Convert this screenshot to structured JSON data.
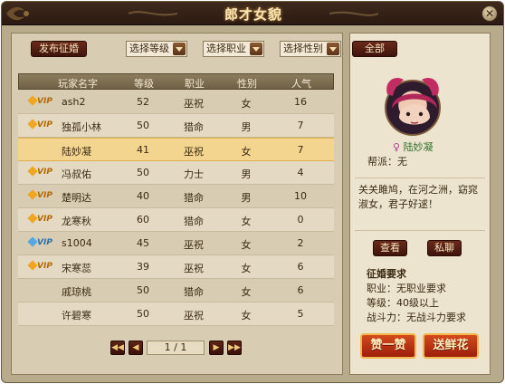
{
  "window": {
    "title": "郎才女貌",
    "close_glyph": "✕"
  },
  "toolbar": {
    "post_button": "发布征婚",
    "level_select": "选择等级",
    "job_select": "选择职业",
    "gender_select": "选择性别",
    "all_button": "全部"
  },
  "table": {
    "headers": [
      "玩家名字",
      "等级",
      "职业",
      "性别",
      "人气"
    ],
    "rows": [
      {
        "vip": "gold",
        "vip_label": "VIP",
        "name": "ash2",
        "level": "52",
        "job": "巫祝",
        "gender": "女",
        "popularity": "16"
      },
      {
        "vip": "gold",
        "vip_label": "VIP",
        "name": "独孤小林",
        "level": "50",
        "job": "猎命",
        "gender": "男",
        "popularity": "7"
      },
      {
        "vip": "",
        "vip_label": "",
        "name": "陆妙凝",
        "level": "41",
        "job": "巫祝",
        "gender": "女",
        "popularity": "7"
      },
      {
        "vip": "gold",
        "vip_label": "VIP",
        "name": "冯叔佑",
        "level": "50",
        "job": "力士",
        "gender": "男",
        "popularity": "4"
      },
      {
        "vip": "gold",
        "vip_label": "VIP",
        "name": "楚明达",
        "level": "40",
        "job": "猎命",
        "gender": "男",
        "popularity": "10"
      },
      {
        "vip": "gold",
        "vip_label": "VIP",
        "name": "龙寒秋",
        "level": "60",
        "job": "猎命",
        "gender": "女",
        "popularity": "0"
      },
      {
        "vip": "blue",
        "vip_label": "VIP",
        "name": "s1004",
        "level": "45",
        "job": "巫祝",
        "gender": "女",
        "popularity": "2"
      },
      {
        "vip": "gold",
        "vip_label": "VIP",
        "name": "宋寒蕊",
        "level": "39",
        "job": "巫祝",
        "gender": "女",
        "popularity": "6"
      },
      {
        "vip": "",
        "vip_label": "",
        "name": "戚琼桃",
        "level": "50",
        "job": "猎命",
        "gender": "女",
        "popularity": "6"
      },
      {
        "vip": "",
        "vip_label": "",
        "name": "许碧寒",
        "level": "50",
        "job": "巫祝",
        "gender": "女",
        "popularity": "5"
      }
    ],
    "selected_index": 2
  },
  "pagination": {
    "page": "1 / 1",
    "first": "◀◀",
    "prev": "◀",
    "next": "▶",
    "last": "▶▶"
  },
  "profile": {
    "name": "陆妙凝",
    "guild_label": "帮派：无",
    "motto": "关关雎鸠，在河之洲，窈窕淑女，君子好逑！",
    "view_button": "查看",
    "chat_button": "私聊",
    "requirements_title": "征婚要求",
    "job_req": "职业：无职业要求",
    "level_req": "等级：40级以上",
    "power_req": "战斗力：无战斗力要求",
    "like_button": "赞一赞",
    "flower_button": "送鲜花"
  },
  "colors": {
    "accent": "#f4d58f",
    "vip_gold": "#f2a51e",
    "vip_blue": "#53a8e6",
    "button_red": "#9e1e0b"
  },
  "icons": {
    "gender_female": "female-icon",
    "close": "close-icon"
  }
}
